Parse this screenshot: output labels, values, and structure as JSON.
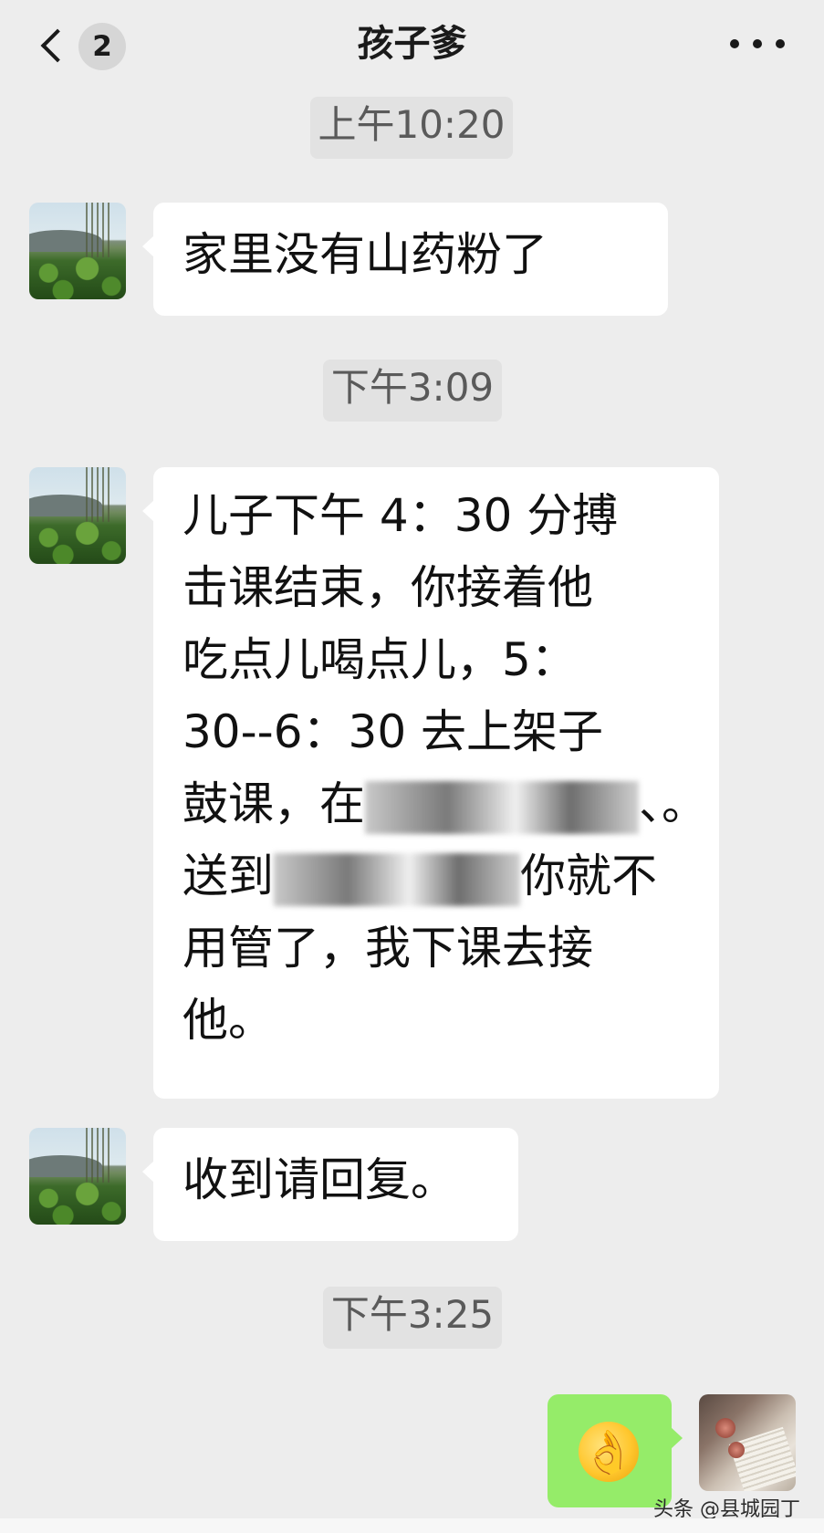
{
  "header": {
    "back_label": "<",
    "unread_count": "2",
    "title": "孩子爹",
    "more_label": "..."
  },
  "messages": [
    {
      "type": "time",
      "text": "上午10:20"
    },
    {
      "type": "incoming",
      "lines": [
        "家里没有山药粉了"
      ]
    },
    {
      "type": "time",
      "text": "下午3:09"
    },
    {
      "type": "incoming",
      "lines": [
        "儿子下午 4：30 分搏",
        "击课结束，你接着他",
        "吃点儿喝点儿，5：",
        "30--6：30 去上架子",
        "鼓课，在",
        "、。",
        "送到",
        "你就不",
        "用管了，我下课去接",
        "他。"
      ]
    },
    {
      "type": "incoming",
      "lines": [
        "收到请回复。"
      ]
    },
    {
      "type": "time",
      "text": "下午3:25"
    },
    {
      "type": "outgoing",
      "emoji": "👌",
      "emoji_name": "ok-hand-emoji"
    }
  ],
  "watermark": "头条 @县城园丁",
  "colors": {
    "background": "#ededed",
    "incoming_bubble": "#ffffff",
    "outgoing_bubble": "#95ec69",
    "timestamp_bg": "#e2e2e2"
  }
}
